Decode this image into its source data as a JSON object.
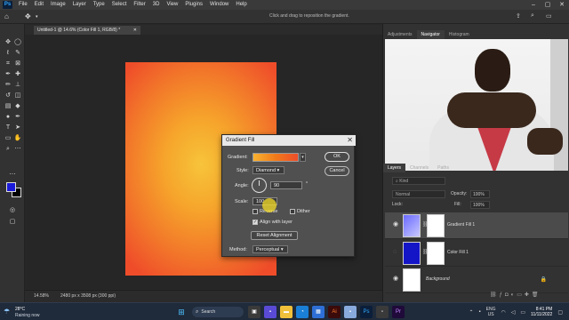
{
  "menubar": {
    "logo": "Ps",
    "items": [
      "File",
      "Edit",
      "Image",
      "Layer",
      "Type",
      "Select",
      "Filter",
      "3D",
      "View",
      "Plugins",
      "Window",
      "Help"
    ]
  },
  "options": {
    "hint": "Click and drag to reposition the gradient."
  },
  "document": {
    "tab_title": "Untitled-1 @ 14.6% (Color Fill 1, RGB/8) *",
    "zoom": "14.58%",
    "info": "2480 px x 3508 px (300 ppi)"
  },
  "panels": {
    "top_tabs": [
      "Adjustments",
      "Navigator",
      "Histogram"
    ],
    "top_active": "Navigator",
    "layer_tabs": [
      "Layers",
      "Channels",
      "Paths"
    ],
    "layer_active": "Layers",
    "kind_placeholder": "Kind",
    "blend_mode": "Normal",
    "opacity_label": "Opacity:",
    "opacity_value": "100%",
    "lock_label": "Lock:",
    "fill_label": "Fill:",
    "fill_value": "100%"
  },
  "layers": [
    {
      "name": "Gradient Fill 1",
      "selected": true
    },
    {
      "name": "Color Fill 1",
      "selected": false
    },
    {
      "name": "Background",
      "selected": false
    }
  ],
  "dialog": {
    "title": "Gradient Fill",
    "gradient_label": "Gradient:",
    "style_label": "Style:",
    "style_value": "Diamond",
    "angle_label": "Angle:",
    "angle_value": "90",
    "angle_unit": "°",
    "scale_label": "Scale:",
    "scale_value": "100",
    "reverse_label": "Reverse",
    "dither_label": "Dither",
    "align_label": "Align with layer",
    "reset_label": "Reset Alignment",
    "method_label": "Method:",
    "method_value": "Perceptual",
    "ok_label": "OK",
    "cancel_label": "Cancel"
  },
  "taskbar": {
    "temperature": "28°C",
    "weather": "Raining now",
    "search": "Search",
    "lang_top": "ENG",
    "lang_bottom": "US",
    "time": "8:41 PM",
    "date": "11/11/2022"
  },
  "colors": {
    "foreground": "#1a1ad8",
    "background": "#000000",
    "accent": "#31a8ff"
  }
}
